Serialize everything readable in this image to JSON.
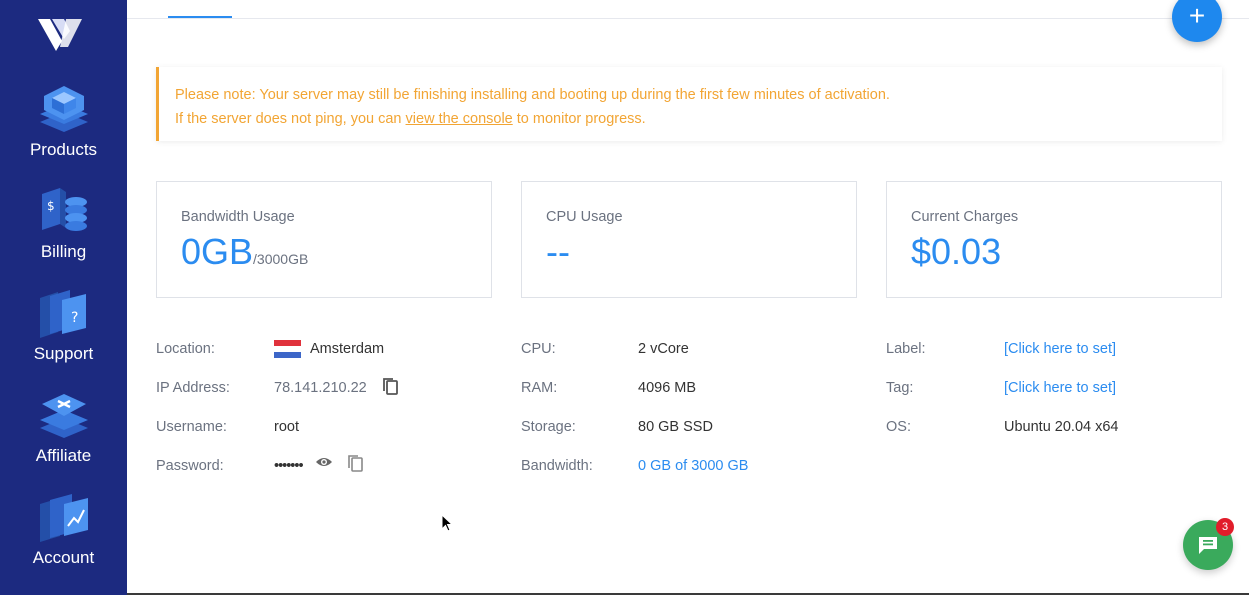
{
  "sidebar": {
    "items": [
      {
        "label": "Products",
        "icon": "products-icon"
      },
      {
        "label": "Billing",
        "icon": "billing-icon"
      },
      {
        "label": "Support",
        "icon": "support-icon"
      },
      {
        "label": "Affiliate",
        "icon": "affiliate-icon"
      },
      {
        "label": "Account",
        "icon": "account-icon"
      }
    ]
  },
  "notice": {
    "line1": "Please note: Your server may still be finishing installing and booting up during the first few minutes of activation.",
    "line2_pre": "If the server does not ping, you can ",
    "line2_link": "view the console",
    "line2_post": " to monitor progress."
  },
  "cards": {
    "bandwidth": {
      "title": "Bandwidth Usage",
      "value": "0GB",
      "suffix": "/3000GB"
    },
    "cpu": {
      "title": "CPU Usage",
      "value": "--"
    },
    "charges": {
      "title": "Current Charges",
      "value": "$0.03"
    }
  },
  "info": {
    "location_label": "Location:",
    "location_value": "Amsterdam",
    "ip_label": "IP Address:",
    "ip_value": "78.141.210.22",
    "username_label": "Username:",
    "username_value": "root",
    "password_label": "Password:",
    "password_value": "•••••••",
    "cpu_label": "CPU:",
    "cpu_value": "2 vCore",
    "ram_label": "RAM:",
    "ram_value": "4096 MB",
    "storage_label": "Storage:",
    "storage_value": "80 GB SSD",
    "bandwidth_label": "Bandwidth:",
    "bandwidth_value": "0 GB of 3000 GB",
    "label_label": "Label:",
    "label_value": "[Click here to set]",
    "tag_label": "Tag:",
    "tag_value": "[Click here to set]",
    "os_label": "OS:",
    "os_value": "Ubuntu 20.04 x64"
  },
  "chat": {
    "badge": "3"
  },
  "colors": {
    "sidebar": "#1c2a80",
    "accent": "#2b8cf0",
    "warning": "#f2a534",
    "chat": "#3aaa5c",
    "badge": "#e11d2a"
  }
}
